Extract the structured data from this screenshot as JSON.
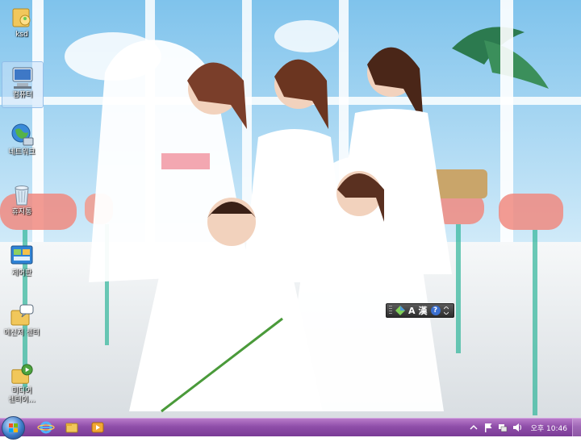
{
  "desktop_icons": [
    {
      "label": "ksd",
      "icon": "user-folder-icon"
    },
    {
      "label": "컴퓨터",
      "icon": "computer-icon"
    },
    {
      "label": "네트워크",
      "icon": "network-icon"
    },
    {
      "label": "휴지통",
      "icon": "recycle-bin-icon"
    },
    {
      "label": "제어판",
      "icon": "control-panel-icon"
    },
    {
      "label": "메신저 센터",
      "icon": "messenger-center-icon"
    },
    {
      "label": "미디어 센터이...",
      "icon": "media-center-icon"
    }
  ],
  "ime_bar": {
    "mode": "A",
    "hanja": "漢",
    "help": "?"
  },
  "taskbar": {
    "pinned": [
      "internet-explorer-icon",
      "windows-explorer-icon",
      "media-player-icon"
    ],
    "clock": "오후 10:46"
  },
  "colors": {
    "taskbar": "#8f4ea9",
    "accent": "#7a3b96"
  }
}
